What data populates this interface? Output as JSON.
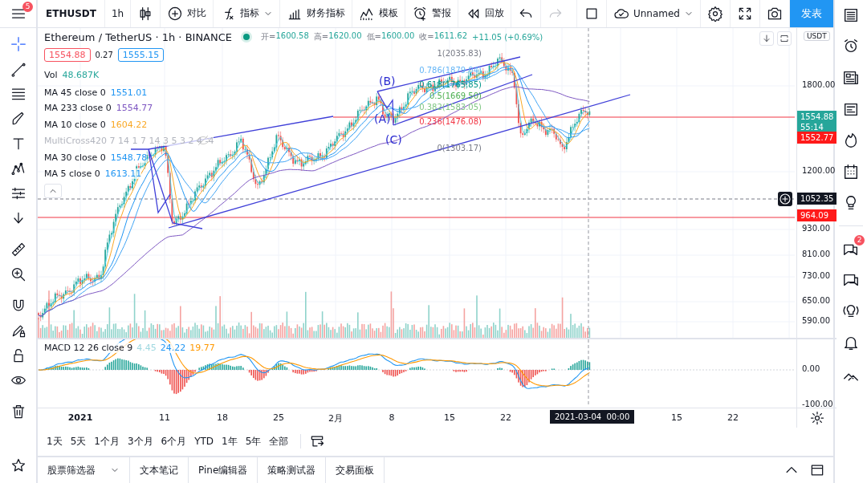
{
  "toolbar": {
    "menu_badge": "5",
    "symbol": "ETHUSDT",
    "interval": "1h",
    "items": [
      {
        "kind": "compare",
        "label": "对比"
      },
      {
        "kind": "indicators",
        "label": "指标"
      },
      {
        "kind": "financials",
        "label": "财务指标"
      },
      {
        "kind": "templates",
        "label": "模板"
      },
      {
        "kind": "alert",
        "label": "警报"
      },
      {
        "kind": "replay",
        "label": "回放"
      }
    ],
    "layout_name": "Unnamed",
    "publish": "发表"
  },
  "legend": {
    "title": "Ethereum / TetherUS · 1h · BINANCE",
    "ohlc": [
      {
        "label": "开=",
        "value": "1600.58"
      },
      {
        "label": "高=",
        "value": "1620.00"
      },
      {
        "label": "低=",
        "value": "1600.00"
      },
      {
        "label": "收=",
        "value": "1611.62"
      }
    ],
    "change": "+11.05 (+0.69%)",
    "bid": "1554.88",
    "spread": "0.27",
    "ask": "1555.15",
    "indicators": [
      {
        "name": "Vol",
        "value": "48.687K",
        "color": "#26a69a",
        "hidden": false
      },
      {
        "name": "MA 45 close 0",
        "value": "1551.01",
        "color": "#2196f3",
        "hidden": false
      },
      {
        "name": "MA 233 close 0",
        "value": "1554.77",
        "color": "#7e57c2",
        "hidden": false
      },
      {
        "name": "MA 10 close 0",
        "value": "1604.22",
        "color": "#f9a825",
        "hidden": false
      },
      {
        "name": "MultiCross420 7 14 1 7 14 3 5 3 2 4 -4",
        "hidden": true
      },
      {
        "name": "MA 30 close 0",
        "value": "1548.78",
        "color": "#2196f3",
        "hidden": false
      },
      {
        "name": "MA 5 close 0",
        "value": "1613.11",
        "color": "#2196f3",
        "hidden": false
      }
    ]
  },
  "fib_levels": [
    {
      "text": "1(2035.83)",
      "color": "#787b86"
    },
    {
      "text": "0.786(1879.04)",
      "color": "#64b5f6"
    },
    {
      "text": "0.618(1765.85)",
      "color": "#009688"
    },
    {
      "text": "0.5(1669.50)",
      "color": "#4caf50"
    },
    {
      "text": "0.382(1583.05)",
      "color": "#81c784"
    },
    {
      "text": "0.236(1476.08)",
      "color": "#f23645"
    },
    {
      "text": "0(1303.17)",
      "color": "#787b86"
    }
  ],
  "wave_labels": [
    "(B)",
    "(A)",
    "(C)"
  ],
  "price_axis": {
    "unit": "USDT",
    "ticks": [
      "1800.00",
      "1200.00",
      "930.00",
      "810.00",
      "730.00",
      "650.00",
      "590.00"
    ],
    "tags": [
      {
        "kind": "last",
        "value": "1554.88",
        "countdown": "55:14",
        "color": "#26a69a"
      },
      {
        "kind": "line",
        "value": "1552.77",
        "color": "#ff1a1a"
      },
      {
        "kind": "crosshair",
        "value": "1052.35"
      },
      {
        "kind": "line",
        "value": "964.09",
        "color": "#ff1a1a"
      }
    ]
  },
  "macd": {
    "name": "MACD 12 26 close 9",
    "values": [
      {
        "value": "4.45",
        "color": "#9fd8e0"
      },
      {
        "value": "24.22",
        "color": "#2196f3"
      },
      {
        "value": "19.77",
        "color": "#ff9800"
      }
    ],
    "ticks": [
      "0.00",
      "-100.00"
    ]
  },
  "time_axis": {
    "ticks": [
      "2021",
      "11",
      "18",
      "25",
      "2月",
      "8",
      "15",
      "22",
      "15",
      "22"
    ],
    "crosshair": "2021-03-04  00:00"
  },
  "ranges": [
    "1天",
    "5天",
    "1个月",
    "3个月",
    "6个月",
    "YTD",
    "1年",
    "5年",
    "全部"
  ],
  "bottom_tabs": [
    "股票筛选器",
    "文本笔记",
    "Pine编辑器",
    "策略测试器",
    "交易面板"
  ],
  "sidebar": {
    "chat_badge": "2"
  }
}
